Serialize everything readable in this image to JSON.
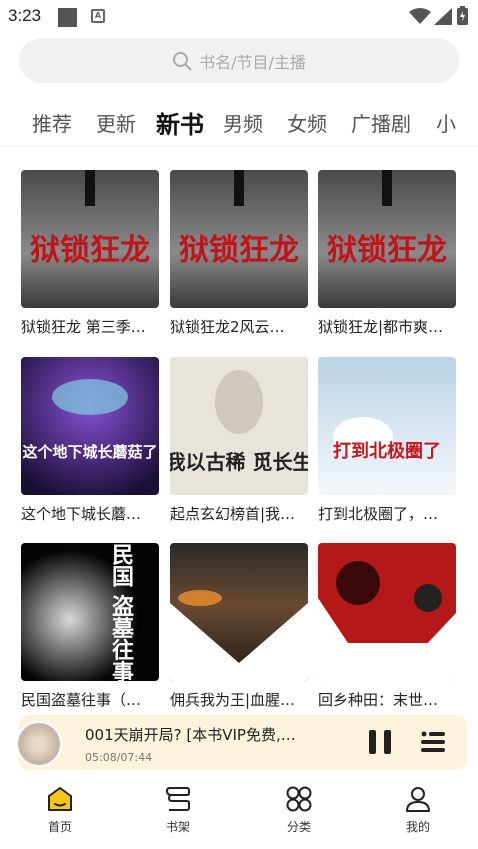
{
  "status": {
    "time": "3:23"
  },
  "search": {
    "placeholder": "书名/节目/主播"
  },
  "tabs": [
    {
      "label": "推荐",
      "active": false
    },
    {
      "label": "更新",
      "active": false
    },
    {
      "label": "新书",
      "active": true
    },
    {
      "label": "男频",
      "active": false
    },
    {
      "label": "女频",
      "active": false
    },
    {
      "label": "广播剧",
      "active": false
    },
    {
      "label": "小",
      "active": false
    }
  ],
  "books": [
    {
      "title": "狱锁狂龙 第三季…",
      "cover_text": "狱锁狂龙",
      "theme": "dark-red"
    },
    {
      "title": "狱锁狂龙2风云…",
      "cover_text": "狱锁狂龙",
      "theme": "dark-red"
    },
    {
      "title": "狱锁狂龙|都市爽…",
      "cover_text": "狱锁狂龙",
      "theme": "dark-red"
    },
    {
      "title": "这个地下城长蘑…",
      "cover_text": "这个地下城长蘑菇了",
      "theme": "purple"
    },
    {
      "title": "起点玄幻榜首|我…",
      "cover_text": "我以古稀 觅长生",
      "theme": "ink"
    },
    {
      "title": "打到北极圈了，…",
      "cover_text": "打到北极圈了",
      "theme": "snow"
    },
    {
      "title": "民国盗墓往事（…",
      "cover_text": "民国 盗墓往事",
      "theme": "black"
    },
    {
      "title": "佣兵我为王|血腥…",
      "cover_text": "",
      "theme": "fire"
    },
    {
      "title": "回乡种田：末世…",
      "cover_text": "",
      "theme": "red-dragon"
    }
  ],
  "player": {
    "title": "001天崩开局?  [本书VIP免费,…",
    "time": "05:08/07:44"
  },
  "nav": [
    {
      "label": "首页",
      "icon": "home-icon",
      "active": true
    },
    {
      "label": "书架",
      "icon": "bookshelf-icon",
      "active": false
    },
    {
      "label": "分类",
      "icon": "category-icon",
      "active": false
    },
    {
      "label": "我的",
      "icon": "profile-icon",
      "active": false
    }
  ],
  "colors": {
    "accent": "#f5c518",
    "player_bg": "#fdf3dc"
  }
}
